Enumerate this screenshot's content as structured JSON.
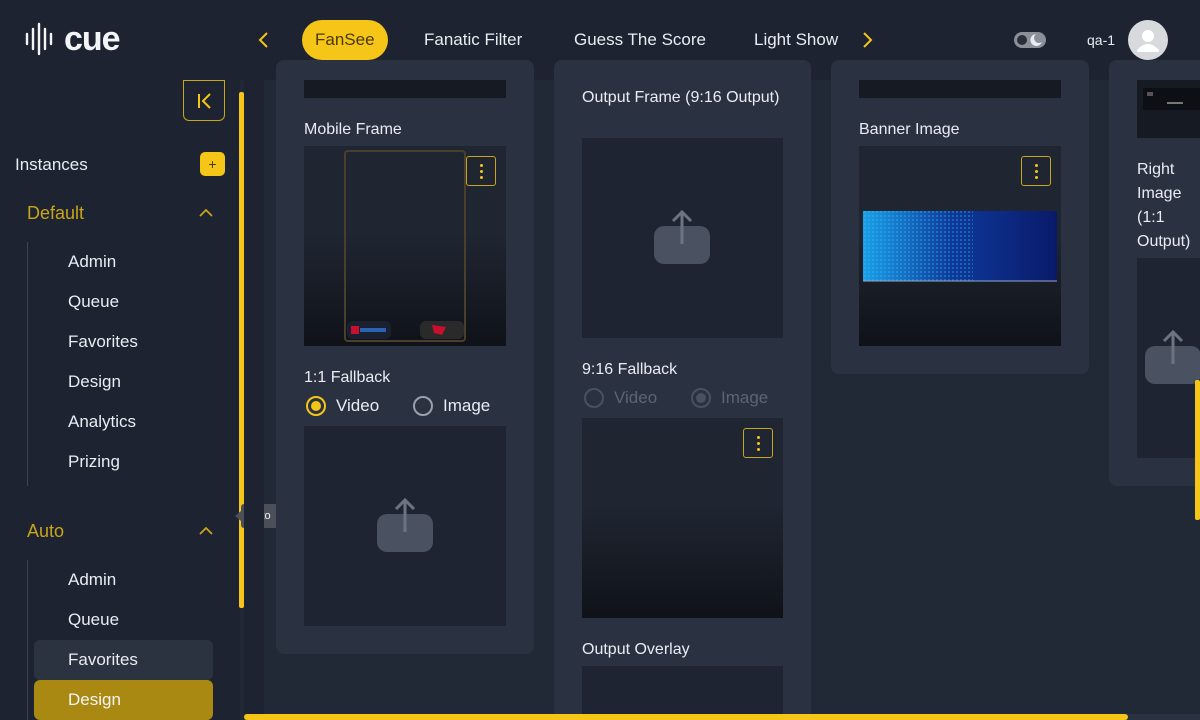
{
  "app": {
    "logo_text": "cue"
  },
  "header": {
    "tabs": [
      {
        "label": "FanSee",
        "active": true
      },
      {
        "label": "Fanatic Filter",
        "active": false
      },
      {
        "label": "Guess The Score",
        "active": false
      },
      {
        "label": "Light Show",
        "active": false
      }
    ],
    "username": "qa-1"
  },
  "sidebar": {
    "instances_label": "Instances",
    "add_label": "+",
    "groups": [
      {
        "label": "Default",
        "items": [
          "Admin",
          "Queue",
          "Favorites",
          "Design",
          "Analytics",
          "Prizing"
        ]
      },
      {
        "label": "Auto",
        "items": [
          "Admin",
          "Queue",
          "Favorites",
          "Design"
        ]
      }
    ],
    "active_item": "Auto / Design",
    "tooltip": "Auto"
  },
  "content": {
    "col1": {
      "mobile_frame_label": "Mobile Frame",
      "fallback_label": "1:1 Fallback",
      "radio_video": "Video",
      "radio_image": "Image",
      "selected": "Video"
    },
    "col2": {
      "output_frame_label": "Output Frame (9:16 Output)",
      "fallback_label": "9:16 Fallback",
      "radio_video": "Video",
      "radio_image": "Image",
      "selected": "Image",
      "output_overlay_label": "Output Overlay"
    },
    "col3": {
      "banner_label": "Banner Image"
    },
    "col4": {
      "right_image_label": "Right Image (1:1 Output)"
    }
  },
  "colors": {
    "accent": "#f5c518",
    "background": "#212836",
    "panel": "#2a3242",
    "sidebar": "#1d2330",
    "active_item": "#a98912"
  }
}
